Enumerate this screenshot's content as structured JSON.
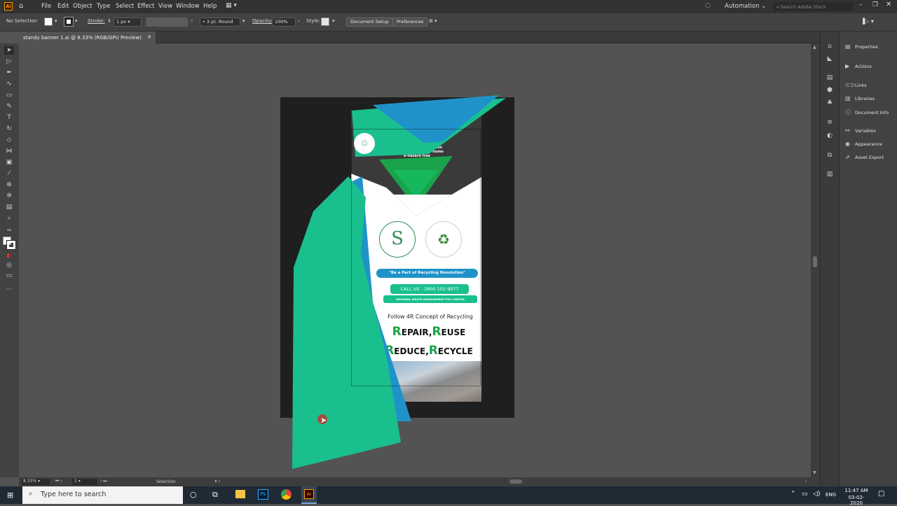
{
  "app": {
    "logo": "Ai",
    "menu": [
      "File",
      "Edit",
      "Object",
      "Type",
      "Select",
      "Effect",
      "View",
      "Window",
      "Help"
    ],
    "workspace": "Automation",
    "search_placeholder": "Search Adobe Stock"
  },
  "controlbar": {
    "selection_state": "No Selection",
    "stroke_label": "Stroke:",
    "stroke_weight": "1 px",
    "brush": "3 pt. Round",
    "opacity_label": "Opacity:",
    "opacity_value": "100%",
    "style_label": "Style:",
    "document_setup": "Document Setup",
    "preferences": "Preferences"
  },
  "document": {
    "tab_title": "standy banner 1.ai @ 8.33% (RGB/GPU Preview)"
  },
  "panels": {
    "items": [
      "Properties",
      "Actions",
      "Links",
      "Libraries",
      "Document Info",
      "Variables",
      "Appearance",
      "Asset Export"
    ]
  },
  "status": {
    "zoom": "8.33%",
    "artboard_num": "1",
    "tool": "Selection"
  },
  "banner": {
    "drop_text": "Drop your e-waste at Swachh Sansar collection point and make your home e-hazard free",
    "slogan": "\"Be a Part of Recycling Revolution\"",
    "call": "CALL US - 1800 102 9077",
    "company": "DESHWAL WASTE MANAGEMENT PVT LIMITED",
    "concept": "Follow 4R Concept of Recycling",
    "line1_a_cap": "R",
    "line1_a_rest": "EPAIR,",
    "line1_b_cap": "R",
    "line1_b_rest": "EUSE",
    "line2_a_cap": "R",
    "line2_a_rest": "EDUCE,",
    "line2_b_cap": "R",
    "line2_b_rest": "ECYCLE"
  },
  "taskbar": {
    "search_placeholder": "Type here to search",
    "lang": "ENG",
    "time": "11:47 AM",
    "date": "03-02-2020"
  },
  "colors": {
    "teal": "#1abf8e",
    "blue": "#1f93c9",
    "green": "#1aa34a"
  }
}
